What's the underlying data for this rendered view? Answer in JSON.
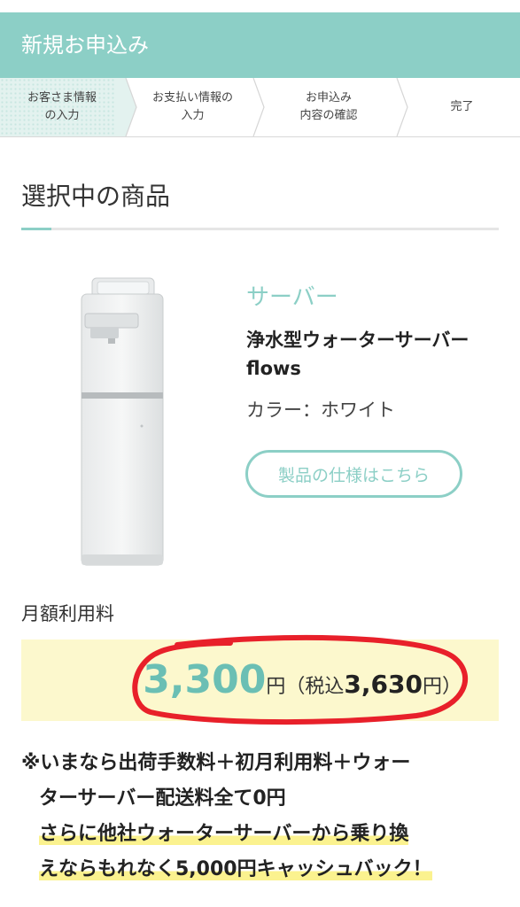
{
  "header": {
    "title": "新規お申込み"
  },
  "steps": [
    {
      "line1": "お客さま情報",
      "line2": "の入力"
    },
    {
      "line1": "お支払い情報の",
      "line2": "入力"
    },
    {
      "line1": "お申込み",
      "line2": "内容の確認"
    },
    {
      "line1": "完了",
      "line2": ""
    }
  ],
  "section": {
    "title": "選択中の商品"
  },
  "product": {
    "category": "サーバー",
    "name_line1": "浄水型ウォーターサーバー",
    "name_line2": "flows",
    "color_label": "カラー：ホワイト",
    "spec_button": "製品の仕様はこちら"
  },
  "fee": {
    "label": "月額利用料",
    "price": "3,300",
    "yen": "円",
    "paren_open": "（税込",
    "tax_price": "3,630",
    "paren_close": "円）"
  },
  "note": {
    "line1": "※いまなら出荷手数料＋初月利用料＋ウォー",
    "line2": "ターサーバー配送料全て0円",
    "line3": "さらに他社ウォーターサーバーから乗り換",
    "line4": "えならもれなく5,000円キャッシュバック！"
  },
  "colors": {
    "accent": "#8ccfc6",
    "price_box": "#fcf8cd",
    "highlight": "#fbf28f",
    "circle": "#e8202a"
  }
}
